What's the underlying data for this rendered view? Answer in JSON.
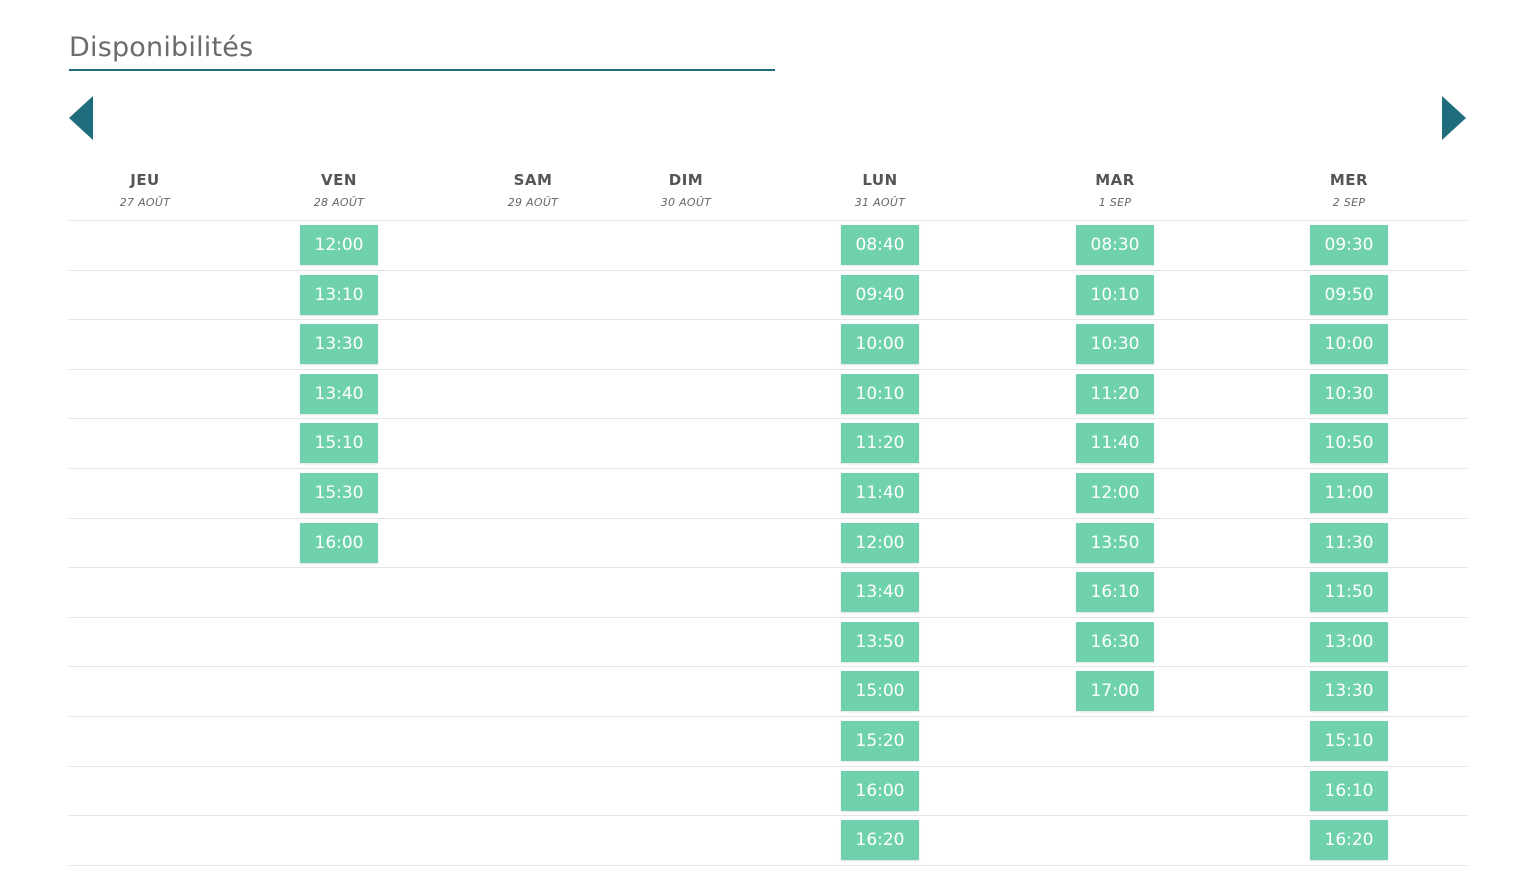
{
  "title": "Disponibilités",
  "nav": {
    "prev_icon": "chevron-left-icon",
    "next_icon": "chevron-right-icon"
  },
  "colors": {
    "accent": "#1f6d7c",
    "slot": "#6fd2ad"
  },
  "days": [
    {
      "name": "JEU",
      "date": "27 AOÛT",
      "slots": []
    },
    {
      "name": "VEN",
      "date": "28 AOÛT",
      "slots": [
        "12:00",
        "13:10",
        "13:30",
        "13:40",
        "15:10",
        "15:30",
        "16:00"
      ]
    },
    {
      "name": "SAM",
      "date": "29 AOÛT",
      "slots": []
    },
    {
      "name": "DIM",
      "date": "30 AOÛT",
      "slots": []
    },
    {
      "name": "LUN",
      "date": "31 AOÛT",
      "slots": [
        "08:40",
        "09:40",
        "10:00",
        "10:10",
        "11:20",
        "11:40",
        "12:00",
        "13:40",
        "13:50",
        "15:00",
        "15:20",
        "16:00",
        "16:20"
      ]
    },
    {
      "name": "MAR",
      "date": "1 SEP",
      "slots": [
        "08:30",
        "10:10",
        "10:30",
        "11:20",
        "11:40",
        "12:00",
        "13:50",
        "16:10",
        "16:30",
        "17:00"
      ]
    },
    {
      "name": "MER",
      "date": "2 SEP",
      "slots": [
        "09:30",
        "09:50",
        "10:00",
        "10:30",
        "10:50",
        "11:00",
        "11:30",
        "11:50",
        "13:00",
        "13:30",
        "15:10",
        "16:10",
        "16:20"
      ]
    }
  ]
}
